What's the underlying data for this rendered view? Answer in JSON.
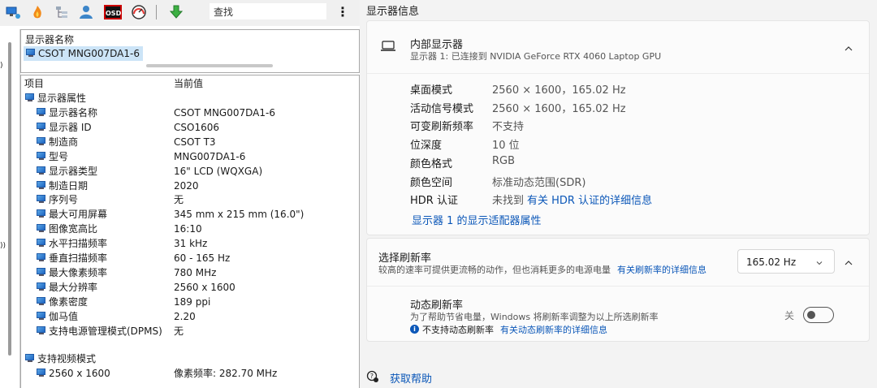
{
  "toolbar": {
    "icons": [
      "monitor-network-icon",
      "flame-icon",
      "tree-icon",
      "person-icon",
      "osd-icon",
      "gauge-icon",
      "download-arrow-icon"
    ],
    "osd_label": "OSD",
    "search_value": "查找",
    "more_label": "⋮"
  },
  "namebox": {
    "header": "显示器名称",
    "value": "CSOT MNG007DA1-6"
  },
  "table": {
    "col_item": "项目",
    "col_value": "当前值",
    "group1": "显示器属性",
    "rows": [
      {
        "k": "显示器名称",
        "v": "CSOT MNG007DA1-6"
      },
      {
        "k": "显示器 ID",
        "v": "CSO1606"
      },
      {
        "k": "制造商",
        "v": "CSOT T3"
      },
      {
        "k": "型号",
        "v": "MNG007DA1-6"
      },
      {
        "k": "显示器类型",
        "v": "16\" LCD (WQXGA)"
      },
      {
        "k": "制造日期",
        "v": "2020"
      },
      {
        "k": "序列号",
        "v": "无"
      },
      {
        "k": "最大可用屏幕",
        "v": "345 mm x 215 mm (16.0\")"
      },
      {
        "k": "图像宽高比",
        "v": "16:10"
      },
      {
        "k": "水平扫描频率",
        "v": "31 kHz"
      },
      {
        "k": "垂直扫描频率",
        "v": "60 - 165 Hz"
      },
      {
        "k": "最大像素频率",
        "v": "780 MHz"
      },
      {
        "k": "最大分辨率",
        "v": "2560 x 1600"
      },
      {
        "k": "像素密度",
        "v": "189 ppi"
      },
      {
        "k": "伽马值",
        "v": "2.20"
      },
      {
        "k": "支持电源管理模式(DPMS)",
        "v": "无"
      }
    ],
    "group2": "支持视频模式",
    "mode_row": {
      "k": "2560 x 1600",
      "v": "像素频率: 282.70 MHz"
    }
  },
  "right": {
    "title": "显示器信息",
    "display": {
      "name": "内部显示器",
      "sub": "显示器 1: 已连接到 NVIDIA GeForce RTX 4060 Laptop GPU"
    },
    "props": [
      {
        "k": "桌面模式",
        "v": "2560 × 1600，165.02 Hz"
      },
      {
        "k": "活动信号模式",
        "v": "2560 × 1600，165.02 Hz"
      },
      {
        "k": "可变刷新频率",
        "v": "不支持"
      },
      {
        "k": "位深度",
        "v": "10 位"
      },
      {
        "k": "颜色格式",
        "v": "RGB"
      },
      {
        "k": "颜色空间",
        "v": "标准动态范围(SDR)"
      }
    ],
    "hdr": {
      "k": "HDR 认证",
      "v": "未找到",
      "link": "有关 HDR 认证的详细信息"
    },
    "adapter_link": "显示器 1 的显示适配器属性",
    "refresh": {
      "title": "选择刷新率",
      "desc": "较高的速率可提供更流畅的动作，但也消耗更多的电源电量",
      "link": "有关刷新率的详细信息",
      "selected": "165.02 Hz"
    },
    "dynamic": {
      "title": "动态刷新率",
      "desc": "为了帮助节省电量，Windows 将刷新率调整为以上所选刷新率",
      "warning": "不支持动态刷新率",
      "link": "有关动态刷新率的详细信息",
      "toggle_label": "关",
      "enabled": false
    },
    "help": "获取帮助"
  },
  "colors": {
    "link": "#0b57b8",
    "icon_blue": "#1f66c2"
  }
}
